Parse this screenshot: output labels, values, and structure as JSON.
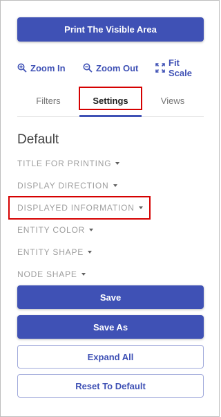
{
  "print_button": {
    "label": "Print The Visible Area"
  },
  "toolbar": {
    "zoom_in": {
      "label": "Zoom In",
      "icon": "zoom-in-icon"
    },
    "zoom_out": {
      "label": "Zoom Out",
      "icon": "zoom-out-icon"
    },
    "fit_scale": {
      "label": "Fit Scale",
      "icon": "fit-scale-icon"
    }
  },
  "tabs": [
    {
      "label": "Filters",
      "active": false
    },
    {
      "label": "Settings",
      "active": true
    },
    {
      "label": "Views",
      "active": false
    }
  ],
  "section": {
    "title": "Default"
  },
  "settings_items": [
    {
      "label": "TITLE FOR PRINTING"
    },
    {
      "label": "DISPLAY DIRECTION"
    },
    {
      "label": "DISPLAYED INFORMATION"
    },
    {
      "label": "ENTITY COLOR"
    },
    {
      "label": "ENTITY SHAPE"
    },
    {
      "label": "NODE SHAPE"
    }
  ],
  "actions": {
    "save": "Save",
    "save_as": "Save As",
    "expand_all": "Expand All",
    "reset_to_default": "Reset To Default"
  },
  "colors": {
    "primary": "#3f51b5",
    "highlight": "#d50000"
  }
}
